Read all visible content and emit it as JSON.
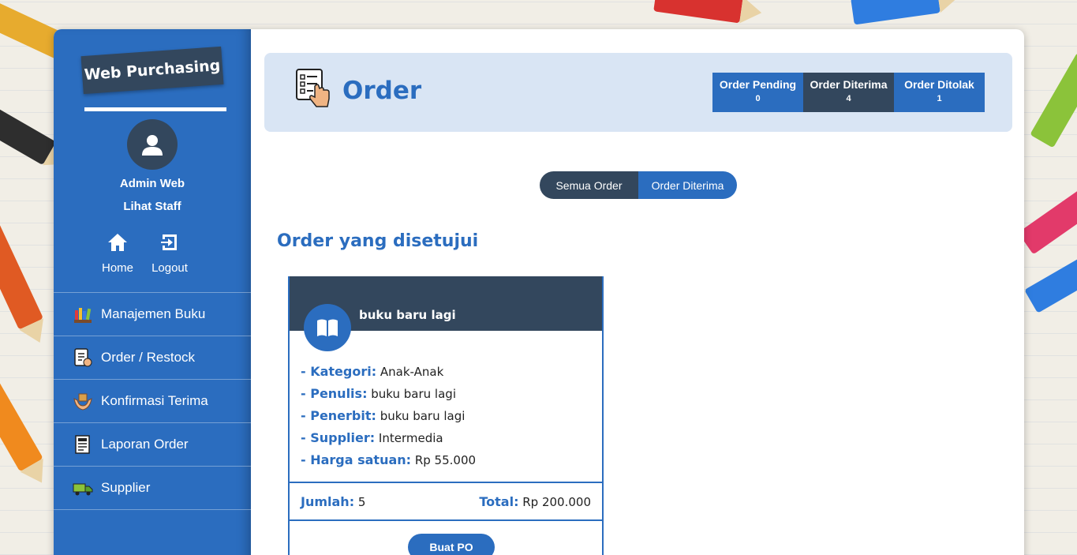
{
  "sidebar": {
    "brand": "Web Purchasing",
    "user_name": "Admin Web",
    "staff_link": "Lihat Staff",
    "home_label": "Home",
    "logout_label": "Logout",
    "menu": [
      {
        "label": "Manajemen Buku",
        "icon": "books-icon"
      },
      {
        "label": "Order / Restock",
        "icon": "order-list-icon"
      },
      {
        "label": "Konfirmasi Terima",
        "icon": "hands-box-icon"
      },
      {
        "label": "Laporan Order",
        "icon": "report-icon"
      },
      {
        "label": "Supplier",
        "icon": "truck-icon"
      }
    ]
  },
  "header": {
    "title": "Order",
    "stats": [
      {
        "label": "Order Pending",
        "count": "0",
        "color": "#2b6dbf"
      },
      {
        "label": "Order Diterima",
        "count": "4",
        "color": "#33475d"
      },
      {
        "label": "Order Ditolak",
        "count": "1",
        "color": "#2b6dbf"
      }
    ]
  },
  "filter": {
    "all_label": "Semua Order",
    "accepted_label": "Order Diterima",
    "active": "Order Diterima"
  },
  "section_title": "Order yang disetujui",
  "order": {
    "title": "buku baru lagi",
    "kategori_key": "- Kategori:",
    "kategori": "Anak-Anak",
    "penulis_key": "- Penulis:",
    "penulis": "buku baru lagi",
    "penerbit_key": "- Penerbit:",
    "penerbit": "buku baru lagi",
    "supplier_key": "- Supplier:",
    "supplier": "Intermedia",
    "harga_key": "- Harga satuan:",
    "harga": "Rp 55.000",
    "jumlah_key": "Jumlah:",
    "jumlah": "5",
    "total_key": "Total:",
    "total": "Rp 200.000",
    "button": "Buat PO"
  },
  "colors": {
    "primary": "#2b6dbf",
    "dark": "#33475d",
    "header_bg": "#d9e5f4"
  }
}
